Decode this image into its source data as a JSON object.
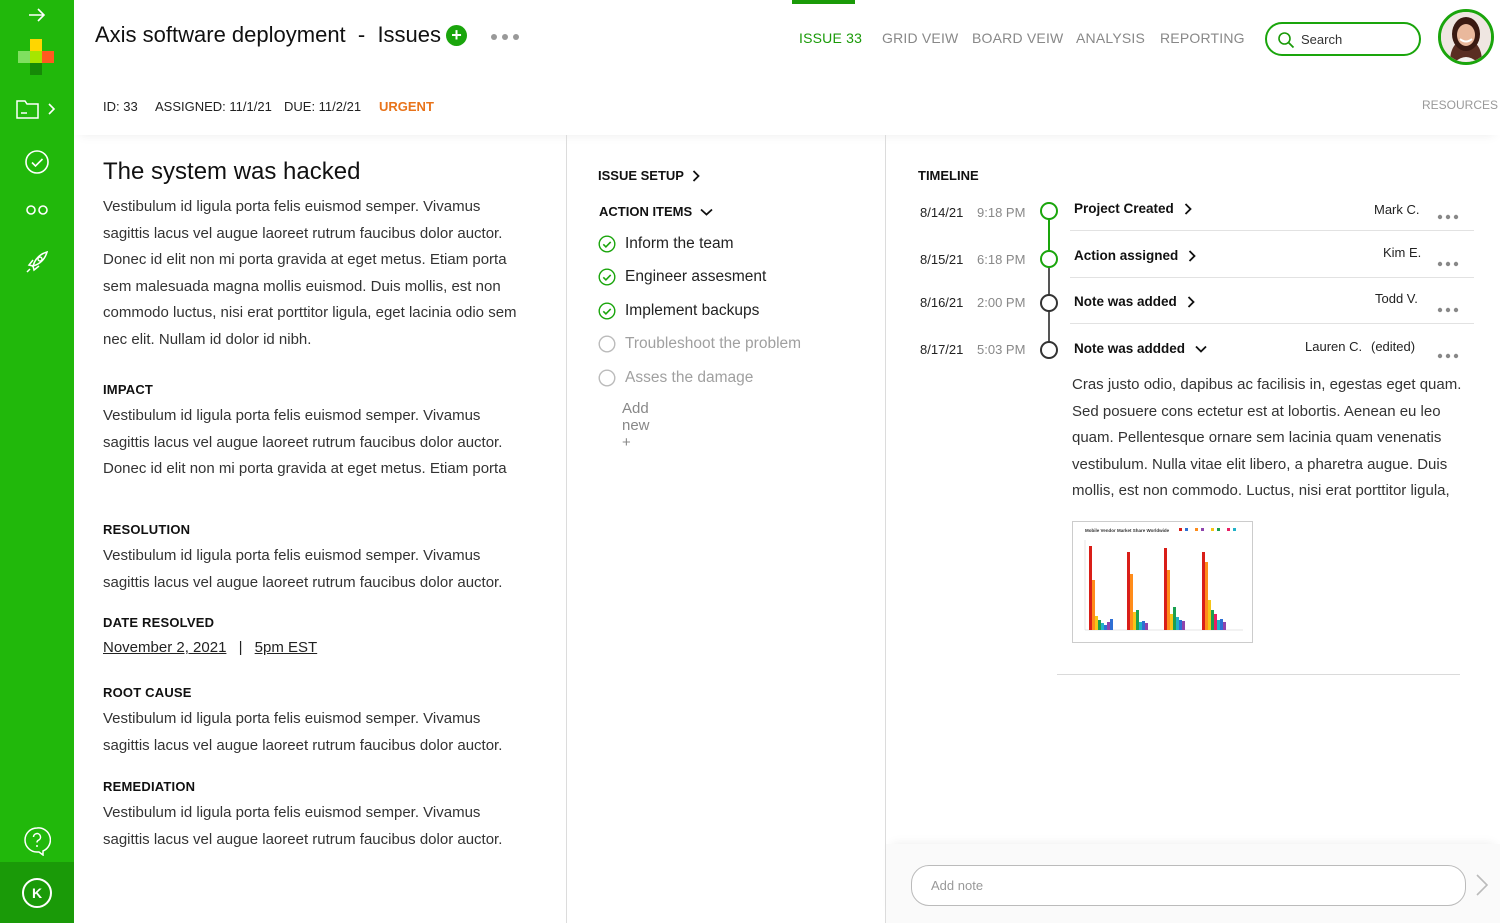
{
  "colors": {
    "brand_green": "#21b80b",
    "accent_green": "#1aa50c",
    "urgent": "#e8731a"
  },
  "sidebar": {
    "items": [
      {
        "icon": "arrow-right-icon"
      },
      {
        "icon": "logo-icon"
      },
      {
        "icon": "folder-icon"
      },
      {
        "icon": "check-circle-icon"
      },
      {
        "icon": "binoculars-icon"
      },
      {
        "icon": "rocket-icon"
      },
      {
        "icon": "help-chat-icon"
      }
    ],
    "user_initial": "K"
  },
  "header": {
    "title": "Axis software deployment  -  Issues",
    "tabs": [
      "ISSUE 33",
      "GRID VEIW",
      "BOARD VEIW",
      "ANALYSIS",
      "REPORTING"
    ],
    "active_tab": "ISSUE 33",
    "search_label": "Search",
    "meta": {
      "id": "ID: 33",
      "assigned": "ASSIGNED: 11/1/21",
      "due": "DUE: 11/2/21",
      "priority": "URGENT"
    },
    "resources": "RESOURCES"
  },
  "issue": {
    "title": "The system was hacked",
    "description": "Vestibulum id ligula porta felis euismod semper. Vivamus sagittis lacus vel augue laoreet rutrum faucibus dolor auctor. Donec id elit non mi porta gravida at eget metus. Etiam porta sem malesuada magna mollis euismod. Duis mollis, est non commodo luctus, nisi erat porttitor ligula, eget lacinia odio sem nec elit. Nullam id dolor id nibh.",
    "impact_heading": "IMPACT",
    "impact_text": "Vestibulum id ligula porta felis euismod semper. Vivamus sagittis lacus vel augue laoreet rutrum faucibus dolor auctor. Donec id elit non mi porta gravida at eget metus. Etiam porta sem malesuada magna mollis euismod.",
    "resolution_heading": "RESOLUTION",
    "resolution_text": "Vestibulum id ligula porta felis euismod semper. Vivamus sagittis lacus vel augue laoreet rutrum faucibus dolor auctor.",
    "date_resolved_heading": "DATE RESOLVED",
    "date_resolved": "November 2, 2021",
    "date_sep": "|",
    "time_resolved": "5pm EST",
    "root_cause_heading": "ROOT CAUSE",
    "root_cause_text": "Vestibulum id ligula porta felis euismod semper. Vivamus sagittis lacus vel augue laoreet rutrum faucibus dolor auctor.",
    "remediation_heading": "REMEDIATION",
    "remediation_text": "Vestibulum id ligula porta felis euismod semper. Vivamus sagittis lacus vel augue laoreet rutrum faucibus dolor auctor."
  },
  "setup": {
    "issue_setup": "ISSUE SETUP",
    "action_items_heading": "ACTION ITEMS",
    "action_items": [
      {
        "label": "Inform the team",
        "done": true
      },
      {
        "label": "Engineer assesment",
        "done": true
      },
      {
        "label": "Implement backups",
        "done": true
      },
      {
        "label": "Troubleshoot the problem",
        "done": false
      },
      {
        "label": "Asses the damage",
        "done": false
      }
    ],
    "add_new": "Add new +"
  },
  "timeline": {
    "heading": "TIMELINE",
    "events": [
      {
        "date": "8/14/21",
        "time": "9:18 PM",
        "title": "Project Created",
        "who": "Mark C.",
        "status": "done"
      },
      {
        "date": "8/15/21",
        "time": "6:18 PM",
        "title": "Action assigned",
        "who": "Kim E.",
        "status": "done"
      },
      {
        "date": "8/16/21",
        "time": "2:00 PM",
        "title": "Note was added",
        "who": "Todd V.",
        "status": "pending"
      },
      {
        "date": "8/17/21",
        "time": "5:03 PM",
        "title": "Note was addded",
        "who": "Lauren C.",
        "edited": "(edited)",
        "status": "pending"
      }
    ],
    "note_text": "Cras justo odio, dapibus ac facilisis in, egestas eget quam. Sed posuere cons ectetur est at lobortis. Aenean eu leo quam. Pellentesque ornare sem lacinia quam venenatis vestibulum. Nulla vitae elit libero, a pharetra augue. Duis mollis, est non commodo. Luctus, nisi erat porttitor ligula,",
    "attachment_title": "Mobile Vendor Market Share Worldwide"
  },
  "note_input": {
    "placeholder": "Add note"
  }
}
